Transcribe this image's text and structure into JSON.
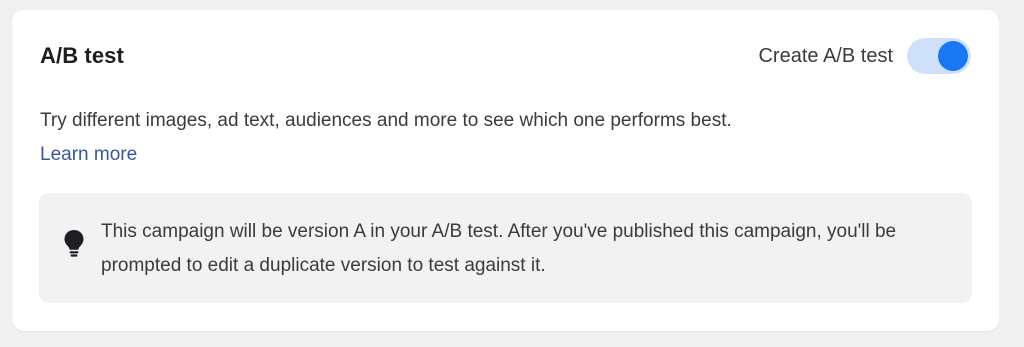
{
  "card": {
    "title": "A/B test",
    "toggle": {
      "label": "Create A/B test",
      "state": "on",
      "accent_color": "#1877f2"
    },
    "description": "Try different images, ad text, audiences and more to see which one performs best.",
    "learn_more": "Learn more",
    "info": {
      "icon": "lightbulb-icon",
      "text": "This campaign will be version A in your A/B test. After you've published this campaign, you'll be prompted to edit a duplicate version to test against it."
    }
  }
}
